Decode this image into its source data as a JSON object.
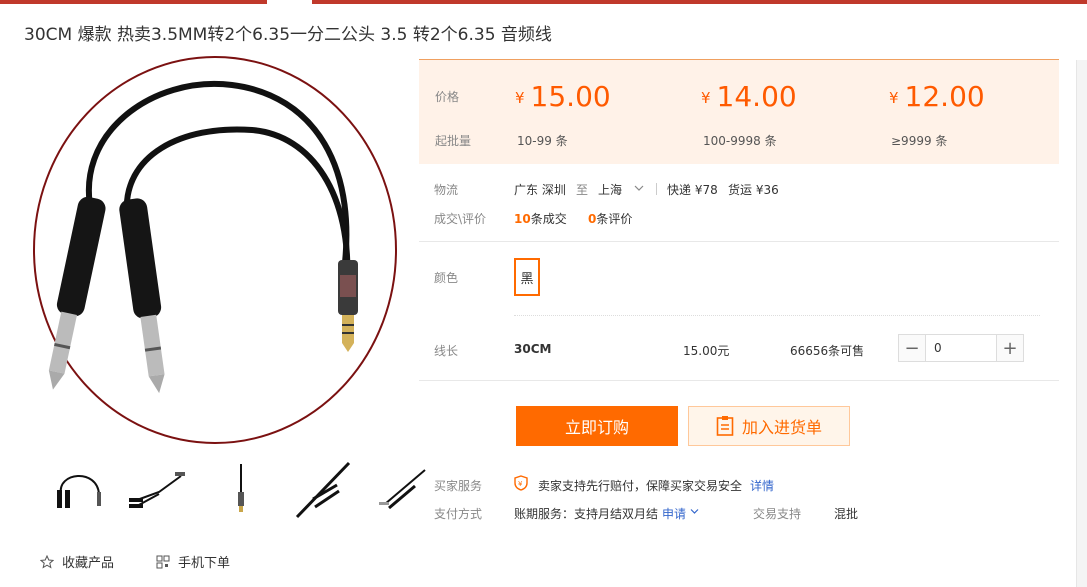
{
  "title": "30CM 爆款 热卖3.5MM转2个6.35一分二公头 3.5 转2个6.35 音频线",
  "price_box": {
    "price_label": "价格",
    "qty_label": "起批量",
    "currency": "¥",
    "tiers": [
      {
        "price": "15.00",
        "qty": "10-99 条"
      },
      {
        "price": "14.00",
        "qty": "100-9998 条"
      },
      {
        "price": "12.00",
        "qty": "≥9999 条"
      }
    ]
  },
  "logistics": {
    "label": "物流",
    "from": "广东 深圳",
    "to_word": "至",
    "to": "上海",
    "express": "快递 ¥78",
    "freight": "货运 ¥36"
  },
  "deals": {
    "label": "成交\\评价",
    "count": "10",
    "count_suffix": "条成交",
    "reviews": "0",
    "reviews_suffix": "条评价"
  },
  "color": {
    "label": "颜色",
    "value": "黑"
  },
  "variant": {
    "label": "线长",
    "name": "30CM",
    "price": "15.00元",
    "stock": "66656条可售",
    "quantity": "0"
  },
  "actions": {
    "buy": "立即订购",
    "cart": "加入进货单"
  },
  "service": {
    "label": "买家服务",
    "text": "卖家支持先行赔付，保障买家交易安全",
    "detail": "详情"
  },
  "payment": {
    "label": "支付方式",
    "text": "账期服务：支持月结双月结",
    "apply": "申请",
    "trade_label": "交易支持",
    "trade_value": "混批"
  },
  "bottom": {
    "favorite": "收藏产品",
    "mobile": "手机下单"
  },
  "colors": {
    "accent": "#ff6a00",
    "price": "#ff5a00",
    "top_bar": "#c0392b",
    "price_bg": "#fff2e8"
  }
}
